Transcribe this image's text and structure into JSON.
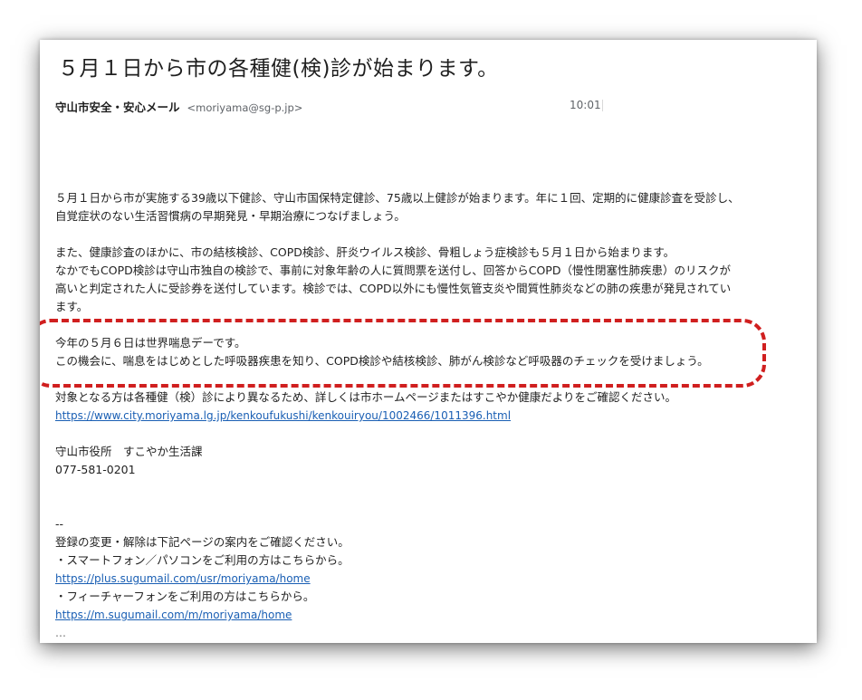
{
  "email": {
    "subject": "５月１日から市の各種健(検)診が始まります。",
    "sender_name": "守山市安全・安心メール",
    "sender_address": "<moriyama@sg-p.jp>",
    "time": "10:01"
  },
  "body": {
    "para1_line1": "５月１日から市が実施する39歳以下健診、守山市国保特定健診、75歳以上健診が始まります。年に１回、定期的に健康診査を受診し、",
    "para1_line2": "自覚症状のない生活習慣病の早期発見・早期治療につなげましょう。",
    "para2_line1": "また、健康診査のほかに、市の結核検診、COPD検診、肝炎ウイルス検診、骨粗しょう症検診も５月１日から始まります。",
    "para2_line2": "なかでもCOPD検診は守山市独自の検診で、事前に対象年齢の人に質問票を送付し、回答からCOPD（慢性閉塞性肺疾患）のリスクが",
    "para2_line3": "高いと判定された人に受診券を送付しています。検診では、COPD以外にも慢性気管支炎や間質性肺炎などの肺の疾患が発見されてい",
    "para2_line4": "ます。",
    "highlight_line1": "今年の５月６日は世界喘息デーです。",
    "highlight_line2": "この機会に、喘息をはじめとした呼吸器疾患を知り、COPD検診や結核検診、肺がん検診など呼吸器のチェックを受けましょう。",
    "info_line": "対象となる方は各種健（検）診により異なるため、詳しくは市ホームページまたはすこやか健康だよりをご確認ください。",
    "info_link": "https://www.city.moriyama.lg.jp/kenkoufukushi/kenkouiryou/1002466/1011396.html",
    "office_name": "守山市役所　すこやか生活課",
    "office_phone": "077-581-0201",
    "separator": "--",
    "footer_intro": "登録の変更・解除は下記ページの案内をご確認ください。",
    "footer_smartphone": "・スマートフォン／パソコンをご利用の方はこちらから。",
    "footer_smartphone_link": "https://plus.sugumail.com/usr/moriyama/home",
    "footer_featurephone": "・フィーチャーフォンをご利用の方はこちらから。",
    "footer_featurephone_link": "https://m.sugumail.com/m/moriyama/home",
    "trimmed_indicator": "..."
  },
  "colors": {
    "highlight_border": "#d01f1f",
    "link": "#1a5fb4"
  }
}
